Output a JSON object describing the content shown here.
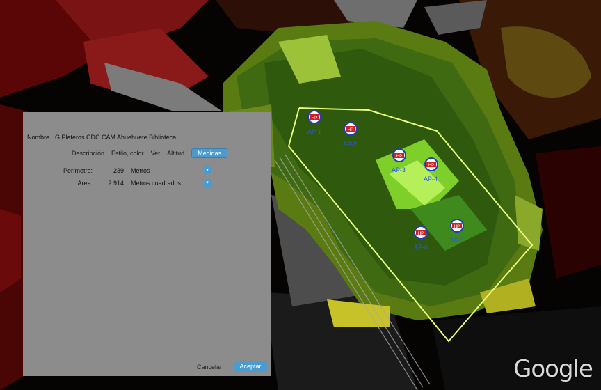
{
  "dialog": {
    "name_label": "Nombre",
    "name_value": "G Plateros CDC CAM Ahuehuete Biblioteca",
    "tabs": [
      "Descripción",
      "Estilo, color",
      "Ver",
      "Altitud",
      "Medidas"
    ],
    "active_tab": "Medidas",
    "measurements": {
      "perimeter_label": "Perímetro:",
      "perimeter_value": "239",
      "perimeter_unit": "Metros",
      "area_label": "Área:",
      "area_value": "2 914",
      "area_unit": "Metros cuadrados"
    },
    "cancel_label": "Cancelar",
    "accept_label": "Aceptar"
  },
  "map": {
    "access_points": [
      "AP-1",
      "AP-2",
      "AP-3",
      "AP-4",
      "AP-5",
      "AP-6"
    ],
    "ap_badge_text": "HP",
    "attribution": "Google"
  },
  "colors": {
    "accent": "#4b9bcf",
    "dialog_bg": "#8c8c8c",
    "ap_label": "#2a55ff",
    "boundary": "#e8ff7a"
  }
}
